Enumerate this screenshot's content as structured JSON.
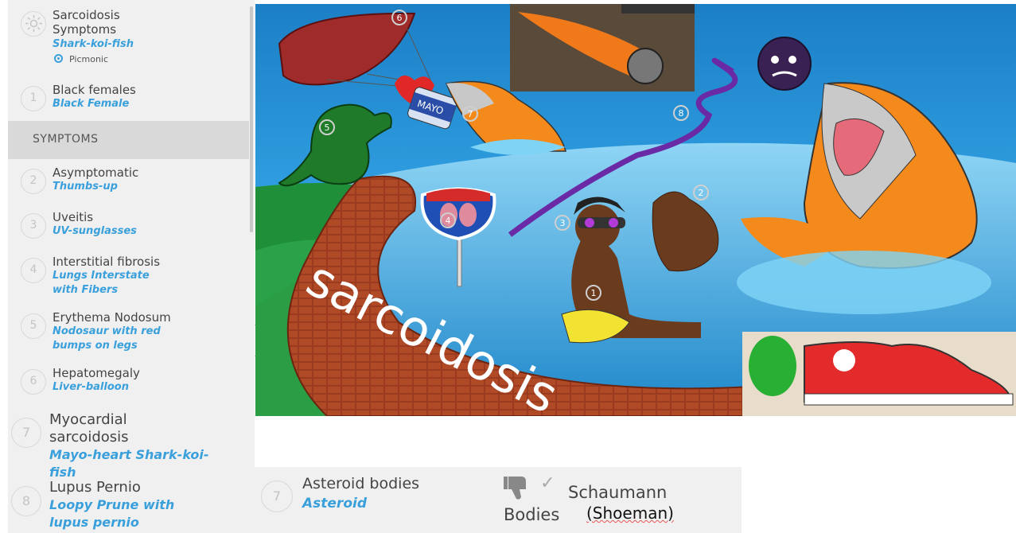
{
  "sidebar": {
    "top_item": {
      "title": "Sarcoidosis Symptoms",
      "subtitle": "Shark-koi-fish",
      "tag": "Picmonic"
    },
    "item1": {
      "number": "1",
      "title": "Black females",
      "subtitle": "Black Female"
    },
    "section_label": "SYMPTOMS",
    "items": [
      {
        "number": "2",
        "title": "Asymptomatic",
        "subtitle": "Thumbs-up"
      },
      {
        "number": "3",
        "title": "Uveitis",
        "subtitle": "UV-sunglasses"
      },
      {
        "number": "4",
        "title": "Interstitial fibrosis",
        "subtitle": "Lungs Interstate with Fibers"
      },
      {
        "number": "5",
        "title": "Erythema Nodosum",
        "subtitle": "Nodosaur with red bumps on legs"
      },
      {
        "number": "6",
        "title": "Hepatomegaly",
        "subtitle": "Liver-balloon"
      },
      {
        "number": "7",
        "title": "Myocardial sarcoidosis",
        "subtitle": "Mayo-heart Shark-koi-fish"
      },
      {
        "number": "8",
        "title": "Lupus Pernio",
        "subtitle": "Loopy Prune with lupus pernio"
      }
    ]
  },
  "scene": {
    "road_text": "sarcoidosis",
    "mayo_label": "MAYO",
    "markers": [
      "1",
      "2",
      "3",
      "4",
      "5",
      "6",
      "7",
      "8"
    ]
  },
  "bottom_card": {
    "number": "7",
    "title": "Asteroid bodies",
    "subtitle": "Asteroid"
  },
  "note_card": {
    "line1": "Schaumann",
    "line2": "(Shoeman)",
    "line3": "Bodies"
  },
  "colors": {
    "accent": "#3aa0dc",
    "sidebar_bg": "#f0f0f0",
    "section_bg": "#d9d9d9"
  }
}
